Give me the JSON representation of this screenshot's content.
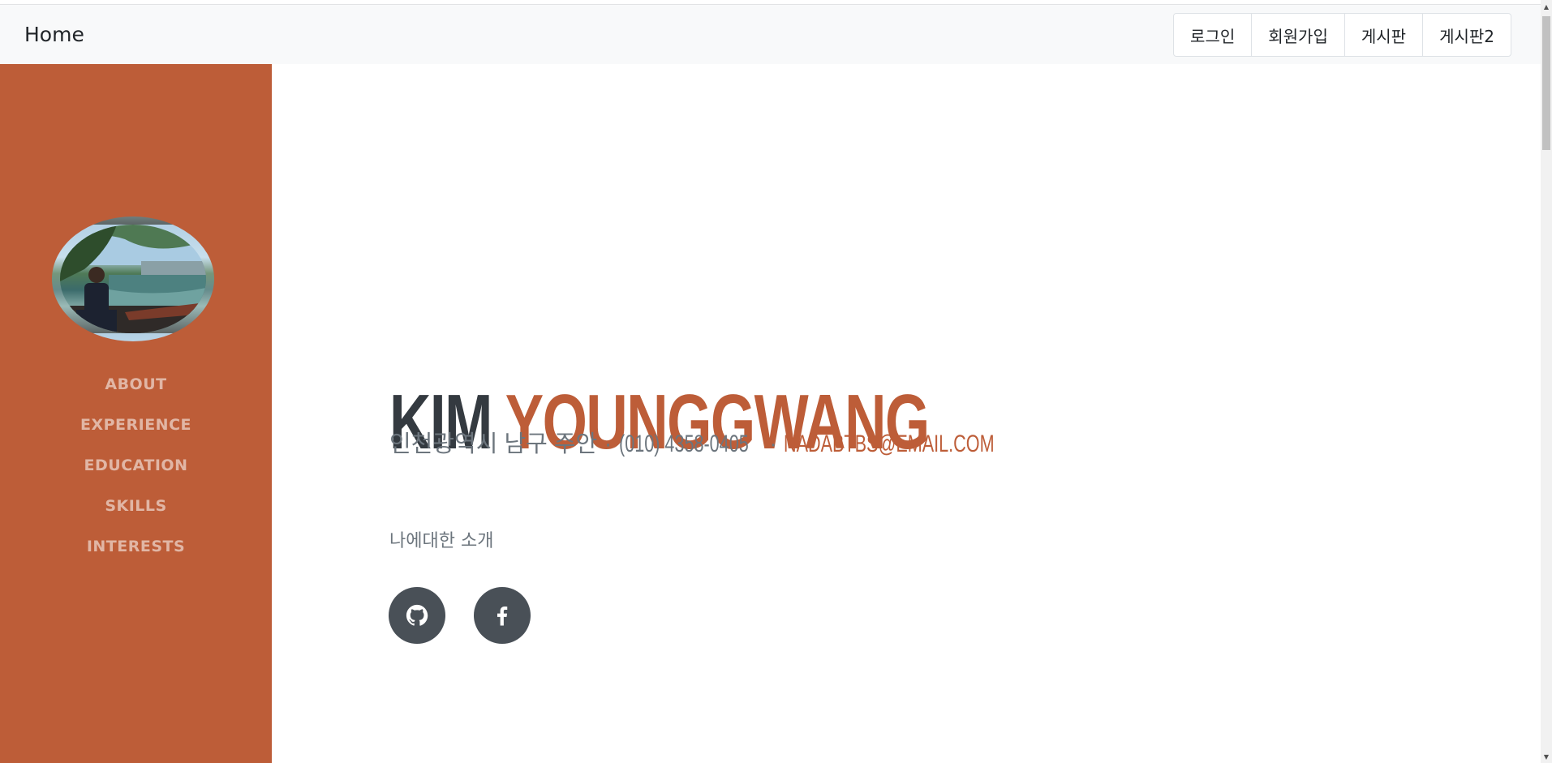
{
  "navbar": {
    "brand": "Home",
    "buttons": [
      "로그인",
      "회원가입",
      "게시판",
      "게시판2"
    ]
  },
  "sidebar": {
    "avatar_icon": "profile-photo",
    "items": [
      "ABOUT",
      "EXPERIENCE",
      "EDUCATION",
      "SKILLS",
      "INTERESTS"
    ]
  },
  "main": {
    "first_name": "KIM",
    "last_name": "YOUNGGWANG",
    "address": "인천광역시 남구 주안",
    "separator": "·",
    "phone": "(010) 4358-0405",
    "email": "NADABTBS@EMAIL.COM",
    "about": "나에대한 소개",
    "social": [
      "github-icon",
      "facebook-icon"
    ]
  },
  "colors": {
    "primary": "#bd5d38",
    "dark": "#343a40",
    "muted": "#6c757d",
    "social_bg": "#495057",
    "navbar_bg": "#f8f9fa"
  }
}
